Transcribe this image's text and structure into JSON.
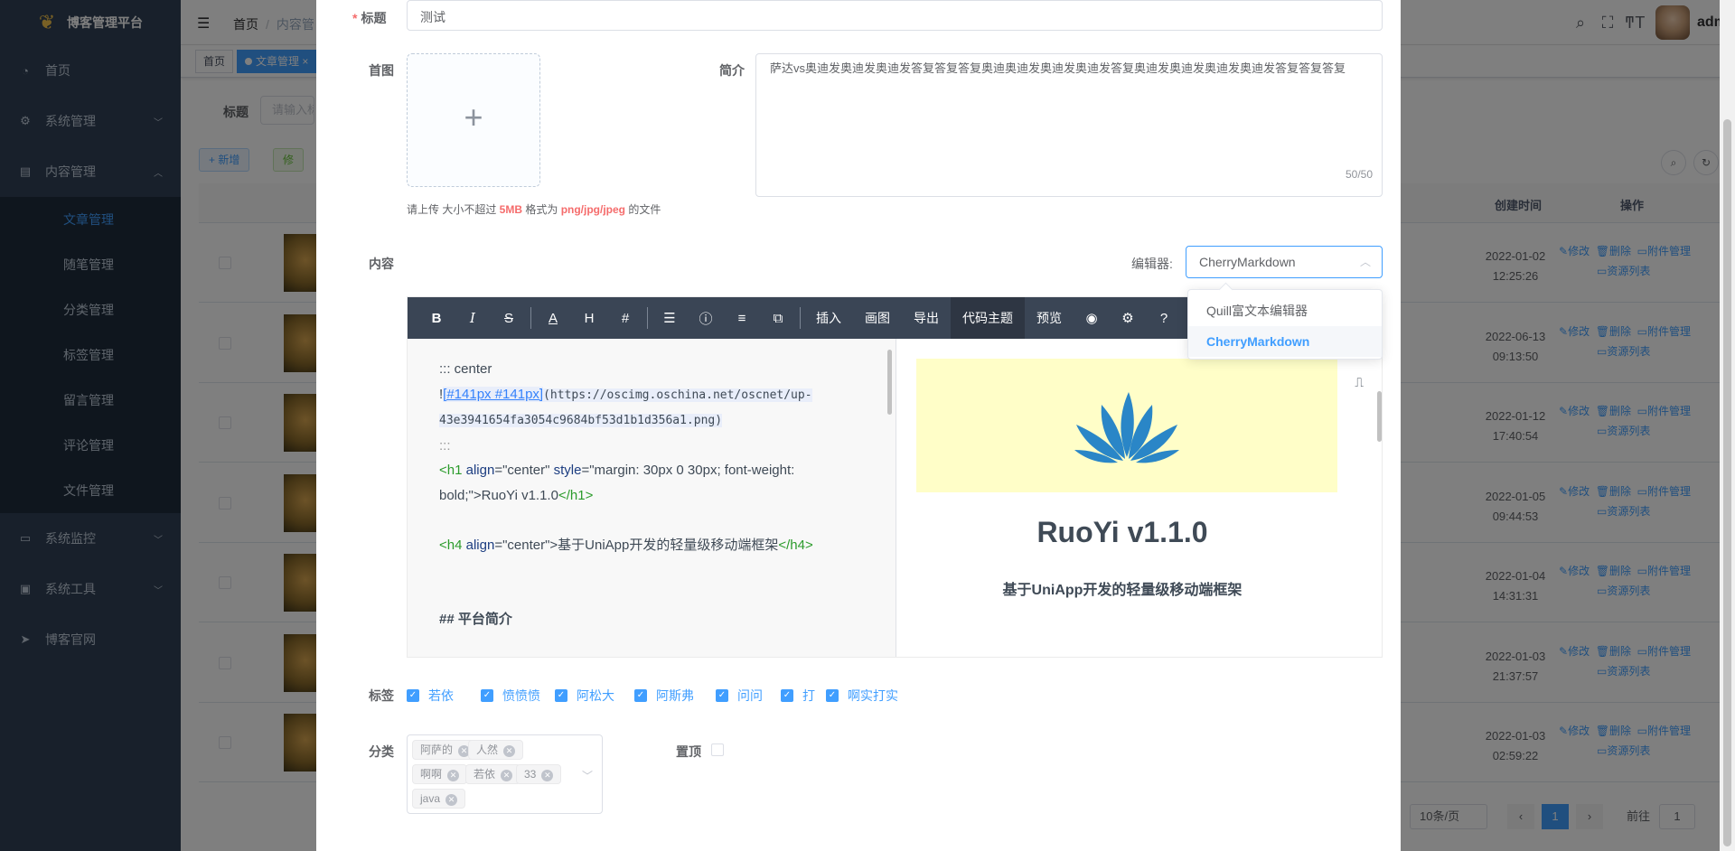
{
  "app": {
    "title": "博客管理平台",
    "user": "admi"
  },
  "sidebar": {
    "items": [
      {
        "label": "首页"
      },
      {
        "label": "系统管理"
      },
      {
        "label": "内容管理"
      },
      {
        "label": "系统监控"
      },
      {
        "label": "系统工具"
      },
      {
        "label": "博客官网"
      }
    ],
    "sub": [
      "文章管理",
      "随笔管理",
      "分类管理",
      "标签管理",
      "留言管理",
      "评论管理",
      "文件管理"
    ]
  },
  "breadcrumb": {
    "home": "首页",
    "current": "内容管"
  },
  "tags_view": {
    "home": "首页",
    "active": "文章管理"
  },
  "bg_page": {
    "filter_label": "标题",
    "filter_placeholder": "请输入标",
    "add_button": "+ 新增",
    "edit_button": "修",
    "col_created": "创建时间",
    "col_ops": "操作",
    "rows": [
      {
        "date": "2022-01-02",
        "time": "12:25:26"
      },
      {
        "date": "2022-06-13",
        "time": "09:13:50"
      },
      {
        "date": "2022-01-12",
        "time": "17:40:54"
      },
      {
        "date": "2022-01-05",
        "time": "09:44:53"
      },
      {
        "date": "2022-01-04",
        "time": "14:31:31"
      },
      {
        "date": "2022-01-03",
        "time": "21:37:57"
      },
      {
        "date": "2022-01-03",
        "time": "02:59:22"
      }
    ],
    "op_edit": "修改",
    "op_delete": "删除",
    "op_attach": "附件管理",
    "op_resources": "资源列表",
    "page_size": "10条/页",
    "current_page": "1",
    "goto_label": "前往",
    "goto_value": "1"
  },
  "dialog": {
    "title_label": "标题",
    "title_value": "测试",
    "cover_label": "首图",
    "upload_tip_prefix": "请上传 大小不超过 ",
    "upload_size": "5MB",
    "upload_tip_mid": " 格式为 ",
    "upload_formats": "png/jpg/jpeg",
    "upload_tip_suffix": " 的文件",
    "summary_label": "简介",
    "summary_value": "萨达vs奥迪发奥迪发奥迪发答复答复答复奥迪奥迪发奥迪发奥迪发答复奥迪发奥迪发奥迪发奥迪发答复答复答复",
    "summary_count": "50/50",
    "content_label": "内容",
    "editor_label": "编辑器:",
    "editor_value": "CherryMarkdown",
    "editor_options": [
      "Quill富文本编辑器",
      "CherryMarkdown"
    ],
    "toolbar": {
      "insert": "插入",
      "draw": "画图",
      "export": "导出",
      "code_theme": "代码主题",
      "preview": "预览"
    },
    "code_lines": {
      "l1": "::: center",
      "l2_img": "!",
      "l2_link": "[#141px #141px]",
      "l2_url": "(https://oscimg.oschina.net/oscnet/up-",
      "l3_url": "43e3941654fa3054c9684bf53d1b1d356a1.png)",
      "l4": ":::",
      "l5_open": "<h1",
      "l5_attr1": " align",
      "l5_val1": "=\"center\"",
      "l5_attr2": " style",
      "l5_val2": "=\"margin: 30px 0 30px; font-weight:",
      "l6_val": "bold;\">RuoYi v1.1.0",
      "l6_close": "</h1>",
      "l7_open": "<h4",
      "l7_attr": " align",
      "l7_val": "=\"center\">基于UniApp开发的轻量级移动端框架",
      "l7_close": "</h4>",
      "l8": "## 平台简介"
    },
    "preview": {
      "h1": "RuoYi v1.1.0",
      "h4": "基于UniApp开发的轻量级移动端框架"
    },
    "tags_label": "标签",
    "tags": [
      "若依",
      "愤愤愤",
      "阿松大",
      "阿斯弗",
      "问问",
      "打",
      "啊实打实"
    ],
    "category_label": "分类",
    "categories": [
      "阿萨的",
      "人然",
      "啊啊",
      "若依",
      "33",
      "java"
    ],
    "top_label": "置顶"
  },
  "colors": {
    "primary": "#409eff",
    "sidebar": "#304156",
    "toolbar": "#3a4555",
    "danger": "#f56c6c"
  }
}
